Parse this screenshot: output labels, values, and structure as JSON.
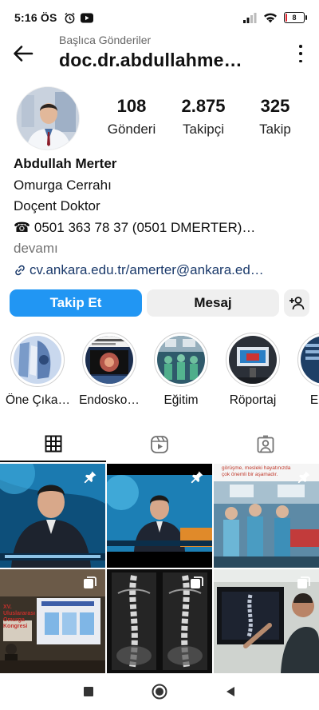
{
  "status_bar": {
    "time": "5:16 ÖS",
    "battery": "8",
    "battery_level": 0.08,
    "icons": [
      "alarm-icon",
      "youtube-icon",
      "signal-icon",
      "wifi-icon",
      "battery-icon"
    ]
  },
  "header": {
    "subtitle": "Başlıca Gönderiler",
    "username": "doc.dr.abdullahme…",
    "icons": [
      "back-arrow-icon",
      "more-vertical-icon"
    ]
  },
  "stats": [
    {
      "value": "108",
      "label": "Gönderi"
    },
    {
      "value": "2.875",
      "label": "Takipçi"
    },
    {
      "value": "325",
      "label": "Takip"
    }
  ],
  "bio": {
    "name": "Abdullah Merter",
    "line1": "Omurga Cerrahı",
    "line2": "Doçent Doktor",
    "phone": "☎ 0501 363 78 37 (0501 DMERTER)…",
    "more": "devamı",
    "link": "cv.ankara.edu.tr/amerter@ankara.ed…"
  },
  "buttons": {
    "follow": "Takip Et",
    "message": "Mesaj"
  },
  "highlights": [
    {
      "label": "Öne Çıka…"
    },
    {
      "label": "Endosko…"
    },
    {
      "label": "Eğitim"
    },
    {
      "label": "Röportaj"
    },
    {
      "label": "Endo"
    }
  ],
  "tabs": [
    "grid-icon",
    "reels-icon",
    "tagged-icon"
  ],
  "grid_overlay_text": {
    "post3_caption": "görüşme, mesleki hayatınızda çok önemli bir aşamadır.",
    "post4_title": "XV. Uluslararası Omurga Kongresi"
  },
  "colors": {
    "accent": "#2196f3",
    "secondary_button": "#efefef",
    "link": "#1b3a6b",
    "muted": "#737373",
    "battery_low": "#e0242f"
  }
}
